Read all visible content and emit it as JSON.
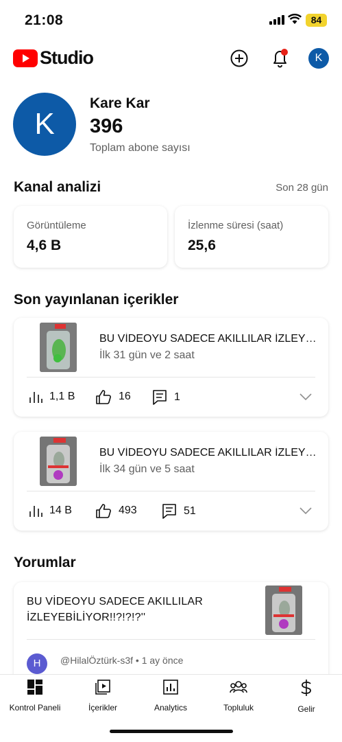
{
  "status_bar": {
    "time": "21:08",
    "battery": "84"
  },
  "app": {
    "logo_text": "Studio",
    "account_initial": "K"
  },
  "profile": {
    "initial": "K",
    "name": "Kare Kar",
    "subscriber_count": "396",
    "subscriber_label": "Toplam abone sayısı"
  },
  "analytics": {
    "title": "Kanal analizi",
    "period": "Son 28 gün",
    "stats": [
      {
        "label": "Görüntüleme",
        "value": "4,6 B"
      },
      {
        "label": "İzlenme süresi (saat)",
        "value": "25,6"
      }
    ]
  },
  "recent": {
    "title": "Son yayınlanan içerikler",
    "videos": [
      {
        "title": "BU VİDEOYU SADECE AKILLILAR İZLEYEBİLİYOR!!?!?!?''",
        "subtitle": "İlk 31 gün ve 2 saat",
        "views": "1,1 B",
        "likes": "16",
        "comments": "1"
      },
      {
        "title": "BU VİDEOYU SADECE AKILLILAR İZLEYEBİLİYOR!!?!?!?''",
        "subtitle": "İlk 34 gün ve 5 saat",
        "views": "14 B",
        "likes": "493",
        "comments": "51"
      }
    ]
  },
  "comments_section": {
    "title": "Yorumlar",
    "video_title_line1": "BU VİDEOYU SADECE AKILLILAR",
    "video_title_line2": "İZLEYEBİLİYOR!!?!?!?''",
    "commenter_initial": "H",
    "commenter": "@HilalÖztürk-s3f",
    "time": "1 ay önce",
    "separator": "•"
  },
  "nav": [
    {
      "label": "Kontrol Paneli",
      "icon": "dashboard-icon"
    },
    {
      "label": "İçerikler",
      "icon": "content-icon"
    },
    {
      "label": "Analytics",
      "icon": "analytics-icon"
    },
    {
      "label": "Topluluk",
      "icon": "community-icon"
    },
    {
      "label": "Gelir",
      "icon": "earn-icon"
    }
  ],
  "colors": {
    "brand_red": "#ff0000",
    "avatar_blue": "#0d5aa7",
    "battery_yellow": "#f2d32d",
    "notification_dot": "#e62117"
  }
}
